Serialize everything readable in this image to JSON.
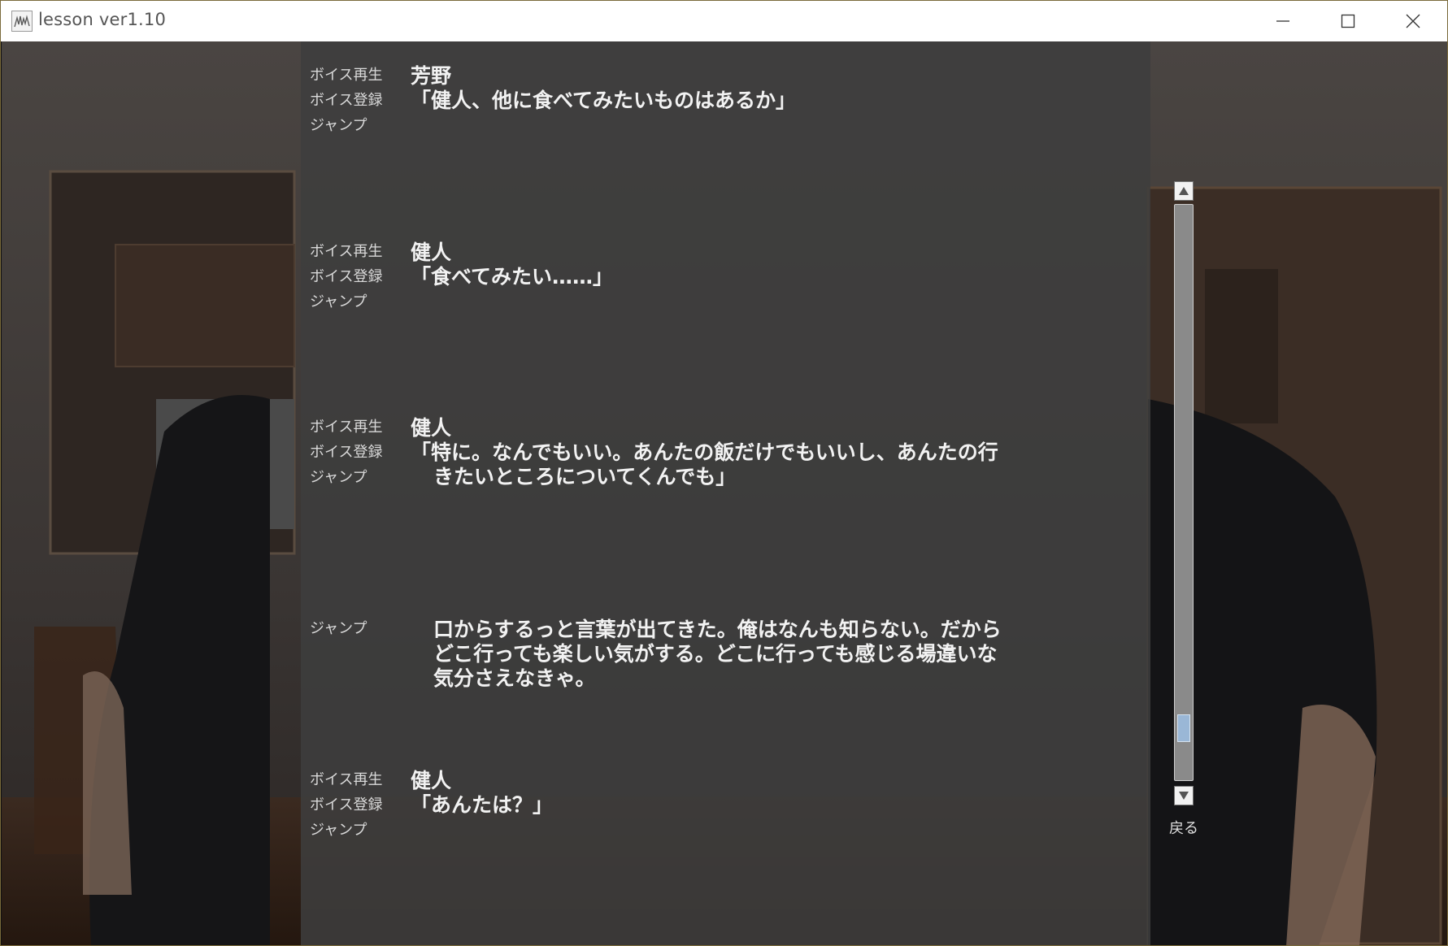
{
  "window": {
    "title": "lesson ver1.10"
  },
  "backlog": {
    "entries": [
      {
        "actions": [
          "ボイス再生",
          "ボイス登録",
          "ジャンプ"
        ],
        "speaker": "芳野",
        "lines": [
          "「健人、他に食べてみたいものはあるか」"
        ]
      },
      {
        "actions": [
          "ボイス再生",
          "ボイス登録",
          "ジャンプ"
        ],
        "speaker": "健人",
        "lines": [
          "「食べてみたい……」"
        ]
      },
      {
        "actions": [
          "ボイス再生",
          "ボイス登録",
          "ジャンプ"
        ],
        "speaker": "健人",
        "lines": [
          "「特に。なんでもいい。あんたの飯だけでもいいし、あんたの行",
          "きたいところについてくんでも」"
        ]
      },
      {
        "actions": [
          "ジャンプ"
        ],
        "speaker": "",
        "lines": [
          "口からするっと言葉が出てきた。俺はなんも知らない。だから",
          "どこ行っても楽しい気がする。どこに行っても感じる場違いな",
          "気分さえなきゃ。"
        ]
      },
      {
        "actions": [
          "ボイス再生",
          "ボイス登録",
          "ジャンプ"
        ],
        "speaker": "健人",
        "lines": [
          "「あんたは？」"
        ]
      }
    ]
  },
  "scrollbar": {
    "position": 0.93,
    "up_icon": "triangle-up-icon",
    "down_icon": "triangle-down-icon"
  },
  "back_label": "戻る",
  "colors": {
    "panel": "#3e3e3e",
    "text": "#f2f2f2",
    "action_text": "#d9d9d9",
    "thumb": "#9ab7d6"
  }
}
